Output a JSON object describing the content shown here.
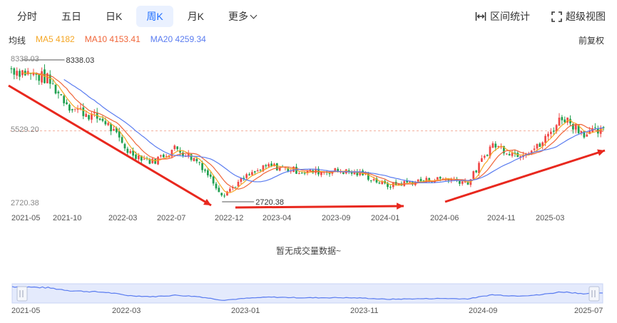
{
  "tabs": [
    {
      "label": "分时",
      "active": false
    },
    {
      "label": "五日",
      "active": false
    },
    {
      "label": "日K",
      "active": false
    },
    {
      "label": "周K",
      "active": true
    },
    {
      "label": "月K",
      "active": false
    },
    {
      "label": "更多",
      "active": false
    }
  ],
  "tools": {
    "interval_stats": "区间统计",
    "super_view": "超级视图"
  },
  "legend": {
    "label": "均线",
    "ma5": "MA5 4182",
    "ma10": "MA10 4153.41",
    "ma20": "MA20 4259.34"
  },
  "adjust_label": "前复权",
  "y_axis": {
    "top": "8338.03",
    "mid": "5529.20",
    "bottom": "2720.38"
  },
  "annotations": {
    "high": "8338.03",
    "low": "2720.38"
  },
  "x_axis": [
    "2021-05",
    "2021-10",
    "2022-03",
    "2022-07",
    "2022-12",
    "2023-04",
    "2023-09",
    "2024-01",
    "2024-06",
    "2024-11",
    "2025-03"
  ],
  "navigator_axis": [
    "2021-05",
    "2022-03",
    "2023-01",
    "2023-11",
    "2024-09",
    "2025-07"
  ],
  "no_volume_text": "暂无成交量数据~",
  "colors": {
    "up": "#f04848",
    "down": "#20a050",
    "ma5": "#f5a623",
    "ma10": "#f0663a",
    "ma20": "#5a7cf0",
    "accent": "#1f6fff",
    "arrow": "#e8281e"
  },
  "chart_data": {
    "type": "candlestick",
    "title": "",
    "interval": "weekly",
    "y_range": [
      2720.38,
      8338.03
    ],
    "reference_price": 5529.2,
    "extremes": {
      "high": 8338.03,
      "low": 2720.38
    },
    "close_path": [
      [
        "2021-05",
        8000
      ],
      [
        "2021-08",
        7600
      ],
      [
        "2021-10",
        6500
      ],
      [
        "2022-01",
        5900
      ],
      [
        "2022-03",
        4700
      ],
      [
        "2022-05",
        4300
      ],
      [
        "2022-07",
        4850
      ],
      [
        "2022-09",
        4300
      ],
      [
        "2022-11",
        3000
      ],
      [
        "2023-01",
        3700
      ],
      [
        "2023-03",
        4150
      ],
      [
        "2023-06",
        3900
      ],
      [
        "2023-09",
        3950
      ],
      [
        "2023-11",
        3800
      ],
      [
        "2024-01",
        3350
      ],
      [
        "2024-03",
        3500
      ],
      [
        "2024-06",
        3650
      ],
      [
        "2024-08",
        3500
      ],
      [
        "2024-10",
        5000
      ],
      [
        "2024-12",
        4600
      ],
      [
        "2025-02",
        4900
      ],
      [
        "2025-04",
        6100
      ],
      [
        "2025-06",
        5400
      ],
      [
        "2025-07",
        5500
      ]
    ],
    "moving_averages": {
      "MA5": 4182,
      "MA10": 4153.41,
      "MA20": 4259.34
    }
  }
}
